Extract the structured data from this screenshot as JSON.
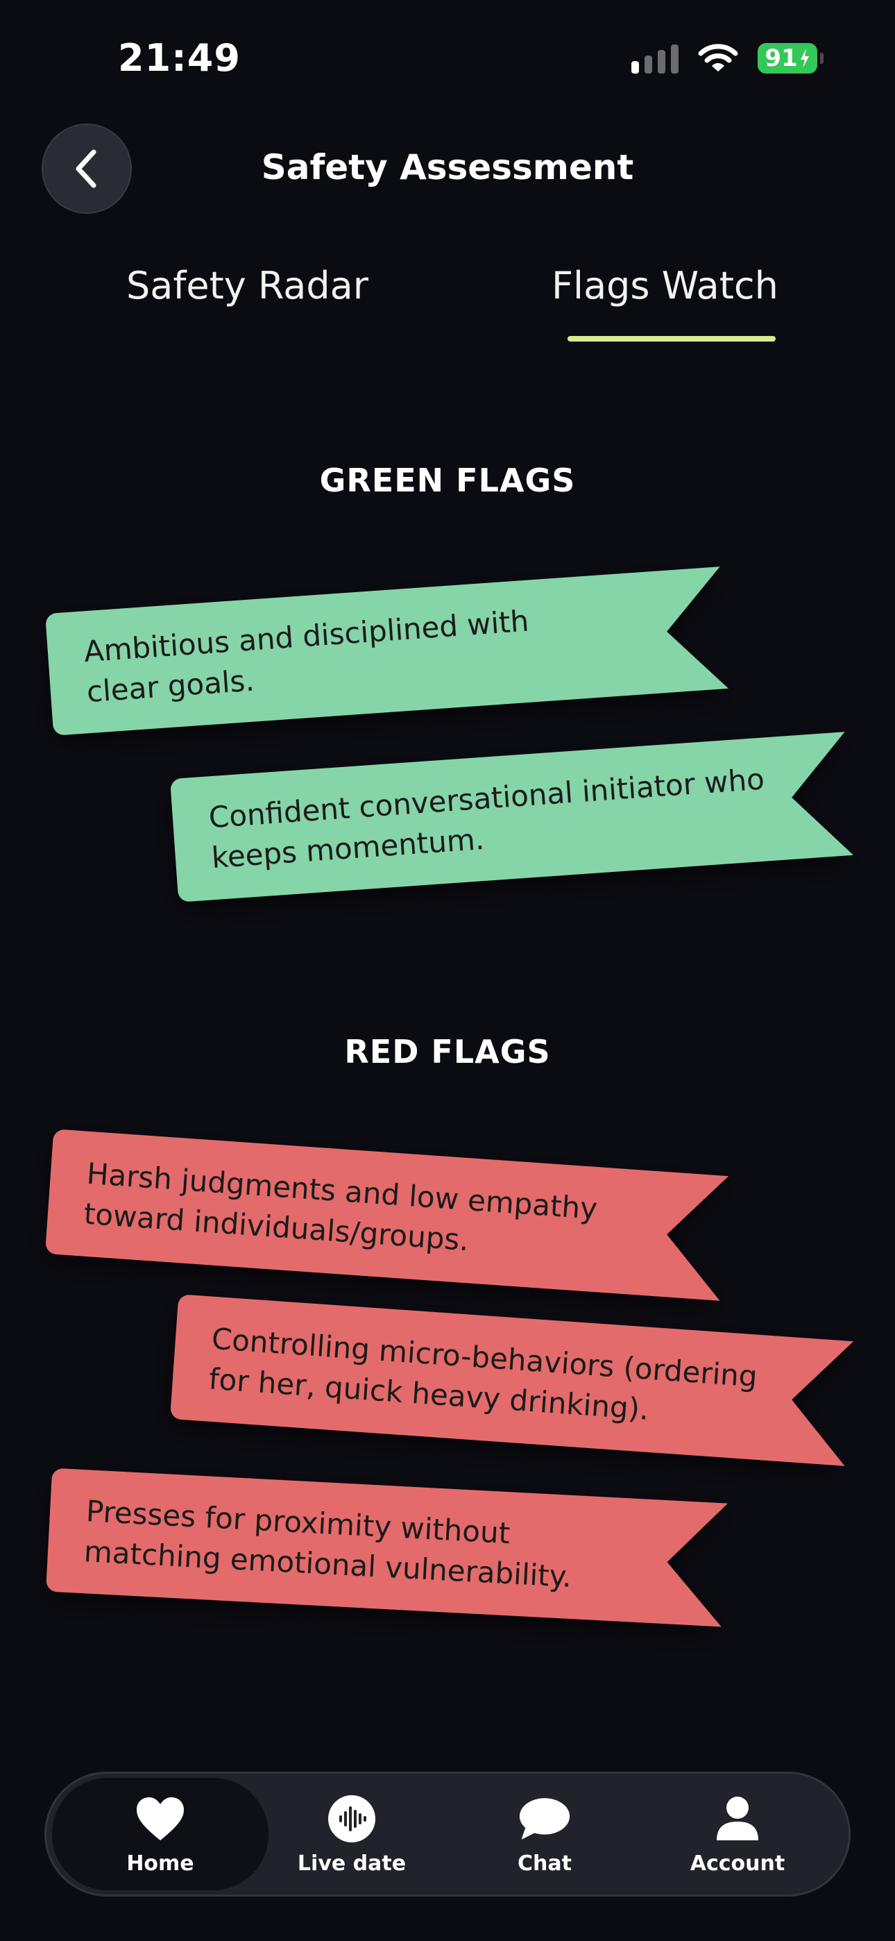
{
  "status": {
    "time": "21:49",
    "battery": "91"
  },
  "header": {
    "title": "Safety Assessment",
    "back_icon": "chevron-left-icon"
  },
  "tabs": [
    {
      "label": "Safety Radar",
      "active": false
    },
    {
      "label": "Flags Watch",
      "active": true
    }
  ],
  "green_flags": {
    "title": "GREEN FLAGS",
    "items": [
      {
        "line1": "Ambitious and disciplined with",
        "line2": "clear goals."
      },
      {
        "line1": "Confident conversational initiator who",
        "line2": "keeps momentum."
      }
    ]
  },
  "red_flags": {
    "title": "RED FLAGS",
    "items": [
      {
        "line1": "Harsh judgments and low empathy",
        "line2": "toward individuals/groups."
      },
      {
        "line1": "Controlling micro-behaviors (ordering",
        "line2": "for her, quick heavy drinking)."
      },
      {
        "line1": "Presses for proximity without",
        "line2": "matching emotional vulnerability."
      }
    ]
  },
  "colors": {
    "background": "#0b0b12",
    "green_flag": "#86d5a9",
    "red_flag": "#e46b6b",
    "tab_accent": "#d6ec8e"
  },
  "nav": [
    {
      "label": "Home",
      "icon": "heart-icon",
      "active": true
    },
    {
      "label": "Live date",
      "icon": "audio-wave-icon",
      "active": false
    },
    {
      "label": "Chat",
      "icon": "chat-bubble-icon",
      "active": false
    },
    {
      "label": "Account",
      "icon": "person-icon",
      "active": false
    }
  ]
}
